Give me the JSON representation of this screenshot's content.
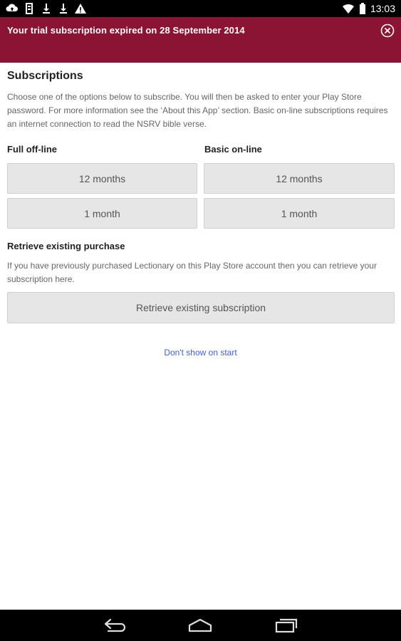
{
  "status_bar": {
    "time": "13:03",
    "left_icons": [
      "cloud-upload-icon",
      "sd-card-icon",
      "download-icon",
      "download-icon",
      "warning-icon"
    ],
    "right_icons": [
      "wifi-icon",
      "battery-icon"
    ]
  },
  "banner": {
    "message": "Your trial subscription expired on 28 September 2014",
    "close_icon": "close-circle-icon",
    "color": "#8a1432"
  },
  "subscriptions": {
    "title": "Subscriptions",
    "description": "Choose one of the options below to subscribe. You will then be asked to enter your Play Store password. For more information see the ‘About this App’ section. Basic on-line subscriptions requires an internet connection to read the NSRV bible verse.",
    "full_offline": {
      "title": "Full off-line",
      "btn_12": "12 months",
      "btn_1": "1 month"
    },
    "basic_online": {
      "title": "Basic on-line",
      "btn_12": "12 months",
      "btn_1": "1 month"
    }
  },
  "retrieve": {
    "title": "Retrieve existing purchase",
    "description": "If you have previously purchased Lectionary on this Play Store account then you can retrieve your subscription here.",
    "button": "Retrieve existing subscription"
  },
  "dont_show_link": "Don't show on start",
  "nav_bar": {
    "icons": [
      "back-icon",
      "home-icon",
      "recent-apps-icon"
    ]
  }
}
